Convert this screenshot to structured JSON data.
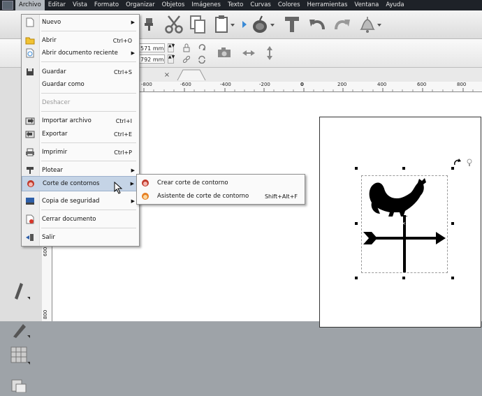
{
  "menubar": {
    "items": [
      "Archivo",
      "Editar",
      "Vista",
      "Formato",
      "Organizar",
      "Objetos",
      "Imágenes",
      "Texto",
      "Curvas",
      "Colores",
      "Herramientas",
      "Ventana",
      "Ayuda"
    ],
    "active": "Archivo"
  },
  "toolbar2": {
    "width_value": "571 mm",
    "height_value": "792 mm"
  },
  "ruler": {
    "labels": [
      "-800",
      "-600",
      "-400",
      "-200",
      "0",
      "200",
      "400",
      "600",
      "800"
    ],
    "left_labels": [
      "600",
      "800"
    ]
  },
  "file_menu": {
    "items": [
      {
        "label": "Nuevo",
        "shortcut": "",
        "submenu": true,
        "icon": "new-document-icon"
      },
      {
        "label": "Abrir",
        "shortcut": "Ctrl+O",
        "submenu": false,
        "icon": "open-folder-icon"
      },
      {
        "label": "Abrir documento reciente",
        "shortcut": "",
        "submenu": true,
        "icon": "recent-document-icon"
      },
      {
        "label": "Guardar",
        "shortcut": "Ctrl+S",
        "submenu": false,
        "icon": "save-icon"
      },
      {
        "label": "Guardar como",
        "shortcut": "",
        "submenu": false,
        "icon": ""
      },
      {
        "label": "Deshacer",
        "shortcut": "",
        "submenu": false,
        "disabled": true,
        "icon": ""
      },
      {
        "label": "Importar archivo",
        "shortcut": "Ctrl+I",
        "submenu": false,
        "icon": "import-icon"
      },
      {
        "label": "Exportar",
        "shortcut": "Ctrl+E",
        "submenu": false,
        "icon": "export-icon"
      },
      {
        "label": "Imprimir",
        "shortcut": "Ctrl+P",
        "submenu": false,
        "icon": "printer-icon"
      },
      {
        "label": "Plotear",
        "shortcut": "",
        "submenu": true,
        "icon": "plotter-icon"
      },
      {
        "label": "Corte de contornos",
        "shortcut": "",
        "submenu": true,
        "highlighted": true,
        "icon": "contour-cut-icon"
      },
      {
        "label": "Copia de seguridad",
        "shortcut": "",
        "submenu": true,
        "icon": "backup-icon"
      },
      {
        "label": "Cerrar documento",
        "shortcut": "",
        "submenu": false,
        "icon": "close-document-icon"
      },
      {
        "label": "Salir",
        "shortcut": "",
        "submenu": false,
        "icon": "exit-icon"
      }
    ]
  },
  "contour_submenu": {
    "items": [
      {
        "label": "Crear corte de contorno",
        "shortcut": "",
        "icon": "contour-cut-icon"
      },
      {
        "label": "Asistente de corte de contorno",
        "shortcut": "Shift+Alt+F",
        "icon": "contour-wizard-icon"
      }
    ]
  },
  "colors": {
    "menubar_bg": "#1e2228",
    "menu_highlight": "#c5d4e6",
    "menu_bg": "#fafafa"
  }
}
